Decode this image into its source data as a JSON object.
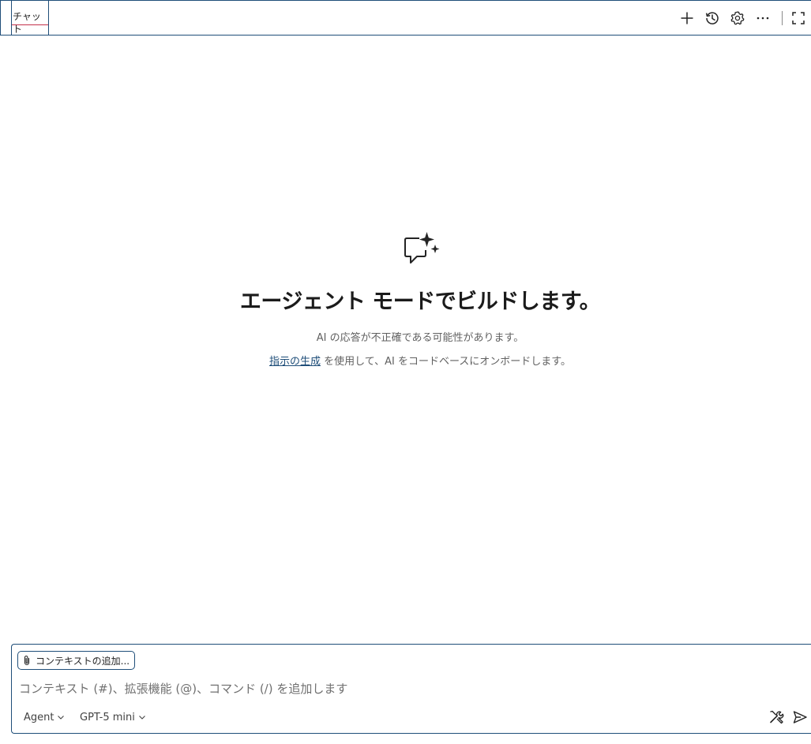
{
  "tab": {
    "label": "チャット"
  },
  "toolbar": {
    "new_chat_icon": "plus-icon",
    "history_icon": "history-icon",
    "settings_icon": "gear-icon",
    "more_icon": "more-icon",
    "maximize_icon": "maximize-icon"
  },
  "empty_state": {
    "icon": "chat-sparkle-icon",
    "title": "エージェント モードでビルドします。",
    "disclaimer": "AI の応答が不正確である可能性があります。",
    "link_text": "指示の生成",
    "link_suffix": " を使用して、AI をコードベースにオンボードします。"
  },
  "input": {
    "context_button_label": "コンテキストの追加...",
    "placeholder": "コンテキスト (#)、拡張機能 (@)、コマンド (/) を追加します",
    "value": "",
    "mode_label": "Agent",
    "model_label": "GPT-5 mini",
    "tools_icon": "tools-icon",
    "send_icon": "send-icon"
  },
  "colors": {
    "border": "#1f4e79",
    "tab_underline": "#c4314b",
    "link": "#1f4e79"
  }
}
